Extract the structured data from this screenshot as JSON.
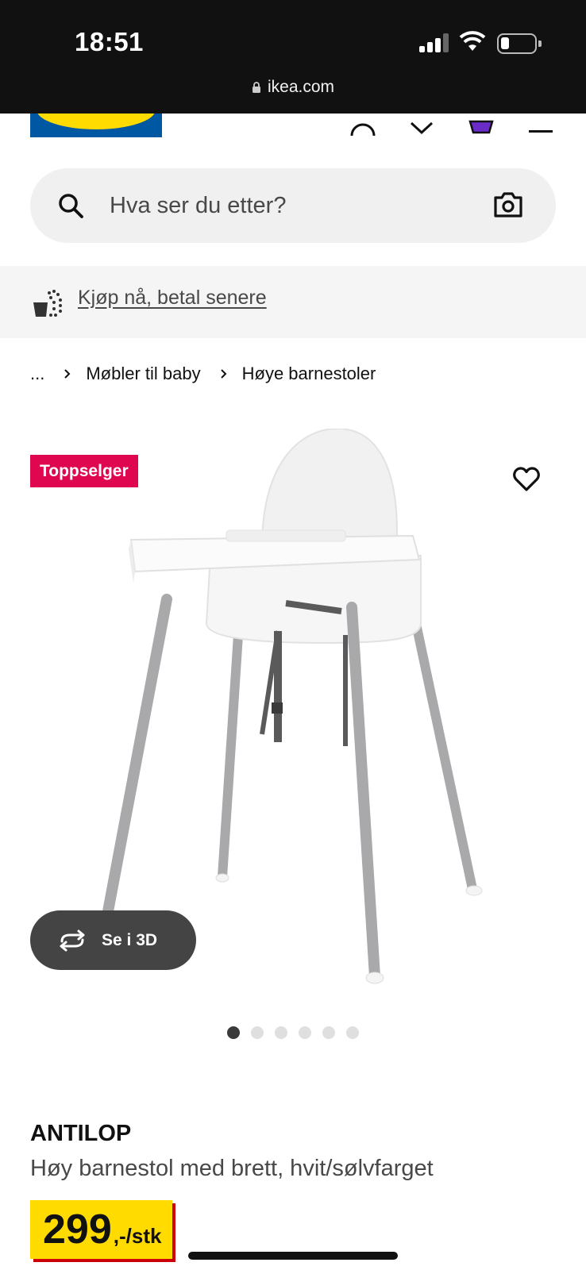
{
  "status_bar": {
    "time": "18:51"
  },
  "browser": {
    "url": "ikea.com"
  },
  "search": {
    "placeholder": "Hva ser du etter?"
  },
  "promo": {
    "link_text": "Kjøp nå, betal senere"
  },
  "breadcrumb": {
    "ellipsis": "...",
    "items": [
      "Møbler til baby",
      "Høye barnestoler"
    ]
  },
  "gallery": {
    "badge": "Toppselger",
    "view_3d_label": "Se i 3D",
    "image_count": 6,
    "active_image": 1
  },
  "product": {
    "name": "ANTILOP",
    "description": "Høy barnestol med brett, hvit/sølvfarget",
    "price_value": "299",
    "price_unit": ",-/stk"
  },
  "colors": {
    "ikea_blue": "#0058a3",
    "ikea_yellow": "#ffdb00",
    "badge_red": "#e00751",
    "price_shadow": "#cc0008"
  }
}
